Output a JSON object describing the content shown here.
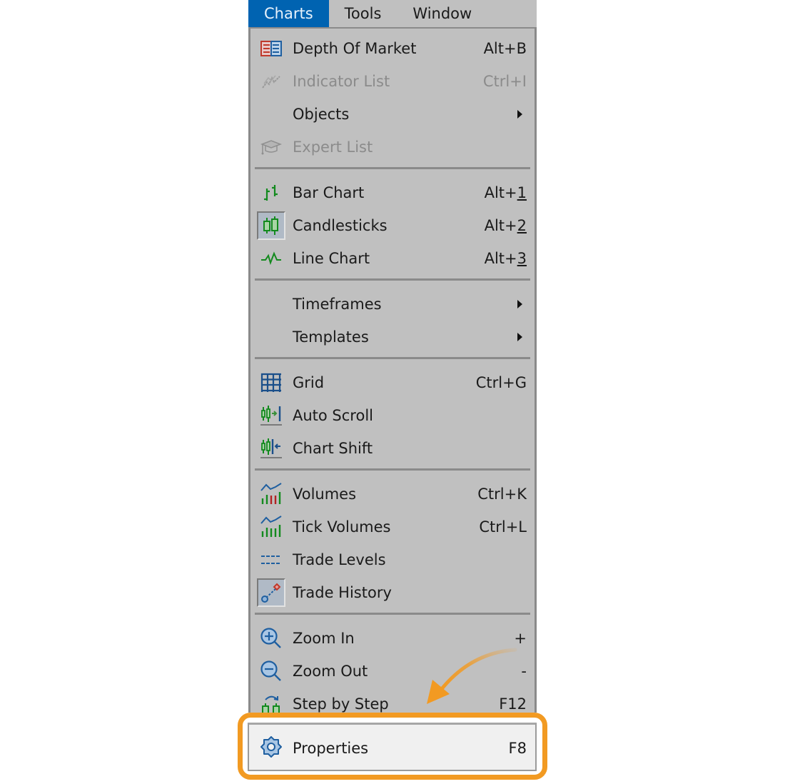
{
  "menubar": {
    "items": [
      {
        "label": "Charts",
        "active": true
      },
      {
        "label": "Tools",
        "active": false
      },
      {
        "label": "Window",
        "active": false
      }
    ]
  },
  "menu": {
    "groups": [
      {
        "items": [
          {
            "label": "Depth Of Market",
            "shortcut": "Alt+B",
            "icon": "depth-of-market-icon",
            "disabled": false
          },
          {
            "label": "Indicator List",
            "shortcut": "Ctrl+I",
            "icon": "indicator-list-icon",
            "disabled": true
          },
          {
            "label": "Objects",
            "shortcut": "",
            "icon": "",
            "submenu": true,
            "disabled": false
          },
          {
            "label": "Expert List",
            "shortcut": "",
            "icon": "expert-list-icon",
            "disabled": true
          }
        ]
      },
      {
        "items": [
          {
            "label": "Bar Chart",
            "shortcut_prefix": "Alt+",
            "shortcut_key": "1",
            "icon": "bar-chart-icon"
          },
          {
            "label": "Candlesticks",
            "shortcut_prefix": "Alt+",
            "shortcut_key": "2",
            "icon": "candlesticks-icon",
            "checked": true
          },
          {
            "label": "Line Chart",
            "shortcut_prefix": "Alt+",
            "shortcut_key": "3",
            "icon": "line-chart-icon"
          }
        ]
      },
      {
        "items": [
          {
            "label": "Timeframes",
            "submenu": true
          },
          {
            "label": "Templates",
            "submenu": true
          }
        ]
      },
      {
        "items": [
          {
            "label": "Grid",
            "shortcut": "Ctrl+G",
            "icon": "grid-icon"
          },
          {
            "label": "Auto Scroll",
            "shortcut": "",
            "icon": "auto-scroll-icon"
          },
          {
            "label": "Chart Shift",
            "shortcut": "",
            "icon": "chart-shift-icon"
          }
        ]
      },
      {
        "items": [
          {
            "label": "Volumes",
            "shortcut": "Ctrl+K",
            "icon": "volumes-icon"
          },
          {
            "label": "Tick Volumes",
            "shortcut": "Ctrl+L",
            "icon": "tick-volumes-icon"
          },
          {
            "label": "Trade Levels",
            "shortcut": "",
            "icon": "trade-levels-icon"
          },
          {
            "label": "Trade History",
            "shortcut": "",
            "icon": "trade-history-icon",
            "checked": true
          }
        ]
      },
      {
        "items": [
          {
            "label": "Zoom In",
            "shortcut": "+",
            "icon": "zoom-in-icon"
          },
          {
            "label": "Zoom Out",
            "shortcut": "-",
            "icon": "zoom-out-icon"
          },
          {
            "label": "Step by Step",
            "shortcut": "F12",
            "icon": "step-by-step-icon"
          }
        ]
      }
    ],
    "highlighted_item": {
      "label": "Properties",
      "shortcut": "F8",
      "icon": "gear-icon"
    }
  },
  "colors": {
    "menu_bg": "#c0c0c0",
    "active_menu_bg": "#0063b1",
    "highlight_accent": "#f29a22",
    "properties_bg": "#f0f0f0"
  }
}
